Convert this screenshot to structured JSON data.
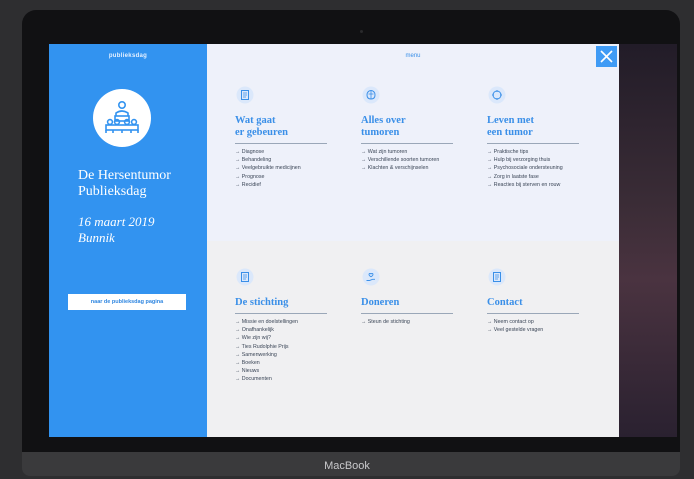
{
  "device": {
    "brand": "MacBook"
  },
  "sidebar": {
    "top_label": "publieksdag",
    "title_lines": [
      "De Hersentumor",
      "Publieksdag"
    ],
    "date_lines": [
      "16 maart 2019",
      "Bunnik"
    ],
    "button_label": "naar de publieksdag pagina"
  },
  "menu": {
    "label": "menu",
    "columns": [
      {
        "title_lines": [
          "Wat gaat",
          "er gebeuren"
        ],
        "items": [
          "→ Diagnose",
          "→ Behandeling",
          "→ Veelgebruikte medicijnen",
          "→ Prognose",
          "→ Recidief"
        ]
      },
      {
        "title_lines": [
          "Alles over",
          "tumoren"
        ],
        "items": [
          "→ Wat zijn tumoren",
          "→ Verschillende soorten tumoren",
          "→ Klachten & verschijnselen"
        ]
      },
      {
        "title_lines": [
          "Leven met",
          "een tumor"
        ],
        "items": [
          "→ Praktische tips",
          "→ Hulp bij verzorging thuis",
          "→ Psychosociale ondersteuning",
          "→ Zorg in laatste fase",
          "→ Reacties bij sterven en rouw"
        ]
      },
      {
        "title_lines": [
          "De stichting"
        ],
        "items": [
          "→ Missie en doelstellingen",
          "→ Onafhankelijk",
          "→ Wie zijn wij?",
          "→ Ties Rudolphie Prijs",
          "→ Samenwerking",
          "→ Boeken",
          "→ Nieuws",
          "→ Documenten"
        ]
      },
      {
        "title_lines": [
          "Doneren"
        ],
        "items": [
          "→ Steun de stichting"
        ]
      },
      {
        "title_lines": [
          "Contact"
        ],
        "items": [
          "→ Neem contact op",
          "→ Veel gestelde vragen"
        ]
      }
    ]
  },
  "icons": {
    "logo": "audience-icon",
    "close": "close-icon",
    "col_icons": [
      "document-icon",
      "brain-icon",
      "heart-icon",
      "document-icon",
      "hand-heart-icon",
      "document-icon"
    ]
  },
  "colors": {
    "accent": "#3293f0",
    "menu_bg_top": "#eef1fa",
    "menu_bg_bottom": "#f0f0f2",
    "close_bg": "#3f9bf5"
  }
}
